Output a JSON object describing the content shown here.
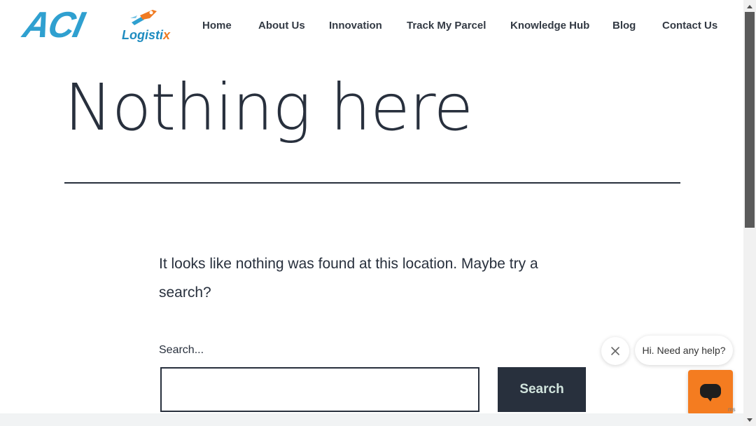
{
  "brand": {
    "logo_main": "ACI",
    "logo_sub_part1": "Logisti",
    "logo_sub_part2": "x",
    "colors": {
      "primary_blue": "#2fa0d0",
      "accent_orange": "#f07b22"
    }
  },
  "nav": {
    "items": [
      {
        "label": "Home"
      },
      {
        "label": "About Us"
      },
      {
        "label": "Innovation"
      },
      {
        "label": "Track My Parcel"
      },
      {
        "label": "Knowledge Hub"
      },
      {
        "label": "Blog"
      },
      {
        "label": "Contact Us"
      }
    ]
  },
  "main": {
    "title": "Nothing here",
    "message": "It looks like nothing was found at this location. Maybe try a search?",
    "search": {
      "label": "Search...",
      "value": "",
      "button_label": "Search"
    }
  },
  "chat": {
    "greeting": "Hi. Need any help?",
    "close_icon": "close-icon",
    "launcher_icon": "chat-bubble-icon",
    "launcher_color": "#f47c20"
  },
  "recaptcha": {
    "fragment": "ms"
  },
  "colors": {
    "text": "#28303d",
    "button_bg": "#28303d",
    "button_text": "#d1e4dd"
  }
}
